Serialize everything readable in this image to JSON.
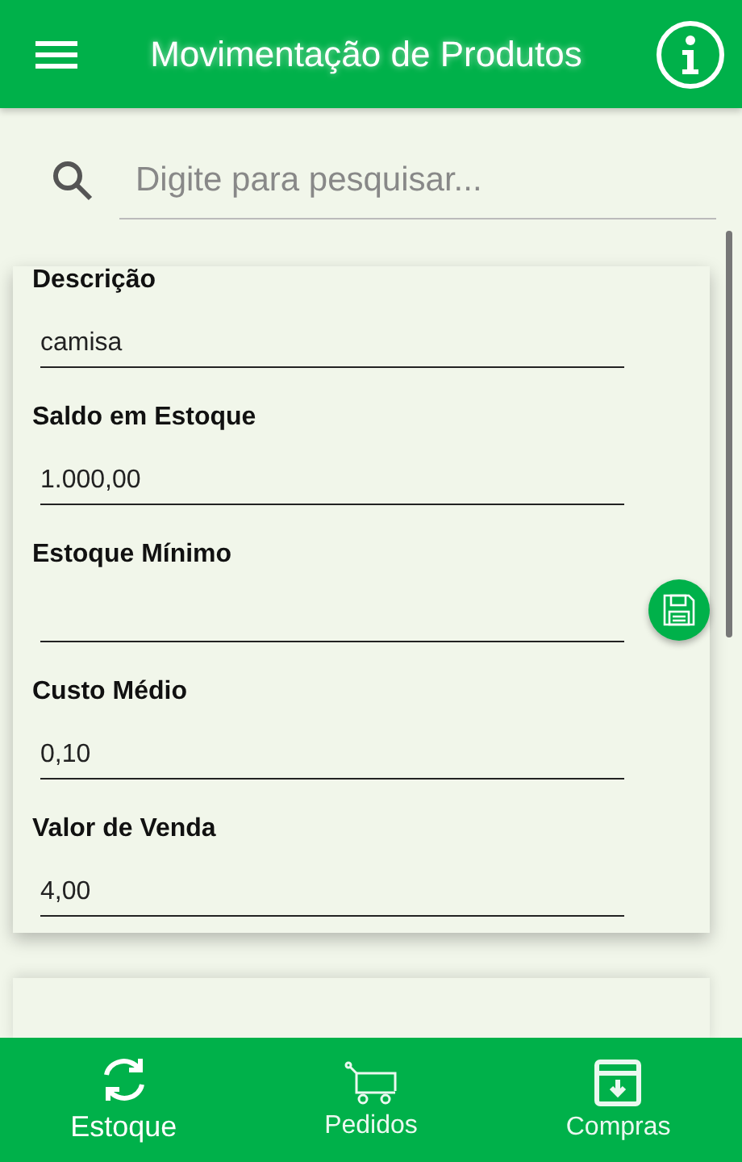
{
  "app_bar": {
    "title": "Movimentação de Produtos"
  },
  "search": {
    "placeholder": "Digite para pesquisar..."
  },
  "products": [
    {
      "fields": [
        {
          "label": "Descrição",
          "value": "camisa"
        },
        {
          "label": "Saldo em Estoque",
          "value": "1.000,00"
        },
        {
          "label": "Estoque Mínimo"
        },
        {
          "label": "Custo Médio",
          "value": "0,10"
        },
        {
          "label": "Valor de Venda",
          "value": "4,00"
        }
      ]
    }
  ],
  "bottom_nav": [
    {
      "label": "Estoque",
      "kind": "sync",
      "selected": true
    },
    {
      "label": "Pedidos",
      "kind": "cart",
      "selected": false
    },
    {
      "label": "Compras",
      "kind": "archive",
      "selected": false
    }
  ]
}
